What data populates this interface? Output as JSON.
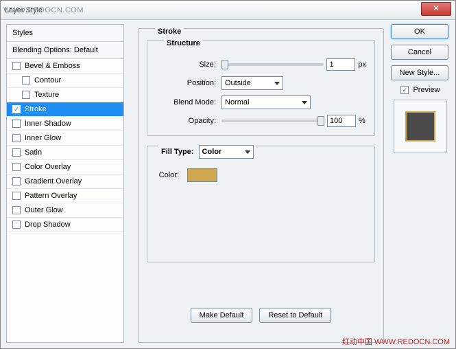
{
  "title": "Layer Style",
  "watermark_top": "WWW.REDOCN.COM",
  "sidebar": {
    "header": "Styles",
    "subheader": "Blending Options: Default",
    "items": [
      {
        "label": "Bevel & Emboss",
        "checked": false,
        "indent": false,
        "selected": false
      },
      {
        "label": "Contour",
        "checked": false,
        "indent": true,
        "selected": false
      },
      {
        "label": "Texture",
        "checked": false,
        "indent": true,
        "selected": false
      },
      {
        "label": "Stroke",
        "checked": true,
        "indent": false,
        "selected": true
      },
      {
        "label": "Inner Shadow",
        "checked": false,
        "indent": false,
        "selected": false
      },
      {
        "label": "Inner Glow",
        "checked": false,
        "indent": false,
        "selected": false
      },
      {
        "label": "Satin",
        "checked": false,
        "indent": false,
        "selected": false
      },
      {
        "label": "Color Overlay",
        "checked": false,
        "indent": false,
        "selected": false
      },
      {
        "label": "Gradient Overlay",
        "checked": false,
        "indent": false,
        "selected": false
      },
      {
        "label": "Pattern Overlay",
        "checked": false,
        "indent": false,
        "selected": false
      },
      {
        "label": "Outer Glow",
        "checked": false,
        "indent": false,
        "selected": false
      },
      {
        "label": "Drop Shadow",
        "checked": false,
        "indent": false,
        "selected": false
      }
    ]
  },
  "panel": {
    "title": "Stroke",
    "structure_title": "Structure",
    "size_label": "Size:",
    "size_value": "1",
    "size_unit": "px",
    "position_label": "Position:",
    "position_value": "Outside",
    "blend_label": "Blend Mode:",
    "blend_value": "Normal",
    "opacity_label": "Opacity:",
    "opacity_value": "100",
    "opacity_unit": "%",
    "filltype_label": "Fill Type:",
    "filltype_value": "Color",
    "color_label": "Color:",
    "color_hex": "#cda84f",
    "make_default": "Make Default",
    "reset_default": "Reset to Default"
  },
  "buttons": {
    "ok": "OK",
    "cancel": "Cancel",
    "new_style": "New Style...",
    "preview": "Preview"
  },
  "footer": "红动中国  WWW.REDOCN.COM"
}
